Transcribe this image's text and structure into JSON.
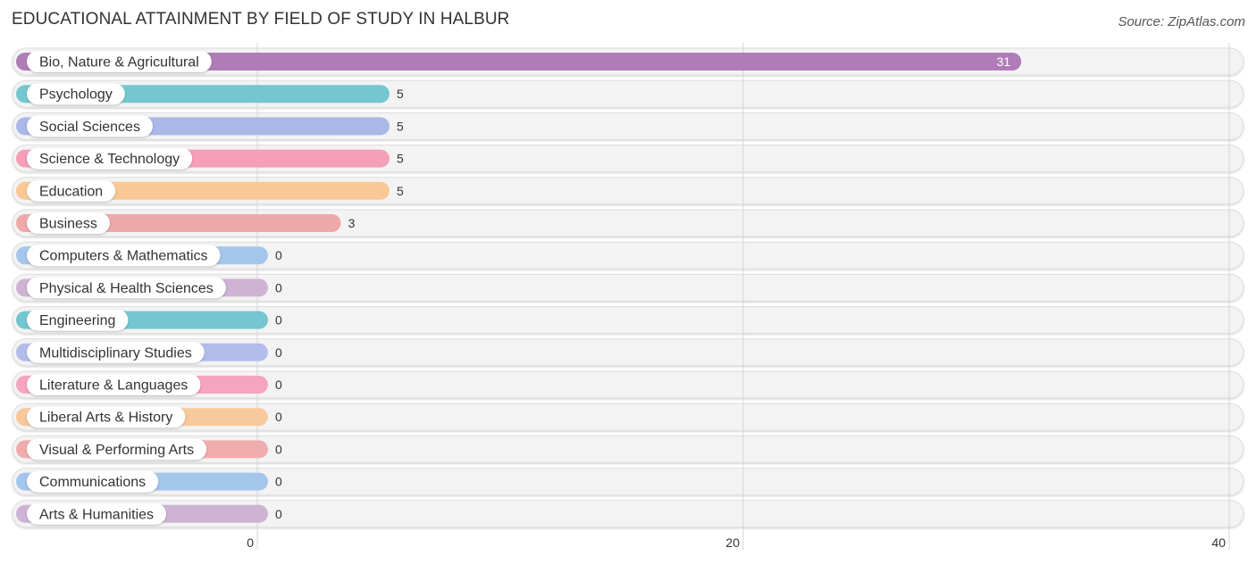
{
  "header": {
    "title": "EDUCATIONAL ATTAINMENT BY FIELD OF STUDY IN HALBUR",
    "source": "Source: ZipAtlas.com"
  },
  "chart_data": {
    "type": "bar",
    "orientation": "horizontal",
    "title": "EDUCATIONAL ATTAINMENT BY FIELD OF STUDY IN HALBUR",
    "xlabel": "",
    "ylabel": "",
    "xlim": [
      0,
      40
    ],
    "xticks": [
      0,
      20,
      40
    ],
    "grid": true,
    "categories": [
      "Bio, Nature & Agricultural",
      "Psychology",
      "Social Sciences",
      "Science & Technology",
      "Education",
      "Business",
      "Computers & Mathematics",
      "Physical & Health Sciences",
      "Engineering",
      "Multidisciplinary Studies",
      "Literature & Languages",
      "Liberal Arts & History",
      "Visual & Performing Arts",
      "Communications",
      "Arts & Humanities"
    ],
    "values": [
      31,
      5,
      5,
      5,
      5,
      3,
      0,
      0,
      0,
      0,
      0,
      0,
      0,
      0,
      0
    ],
    "colors": [
      "#b07cb8",
      "#74c7d0",
      "#aab8e8",
      "#f59fb9",
      "#f9c896",
      "#eea9a9",
      "#a5c6ec",
      "#cfb3d4",
      "#74c7d0",
      "#b3bdec",
      "#f6a5c0",
      "#f9c99e",
      "#f0adad",
      "#a5c6ec",
      "#cfb3d4"
    ]
  }
}
